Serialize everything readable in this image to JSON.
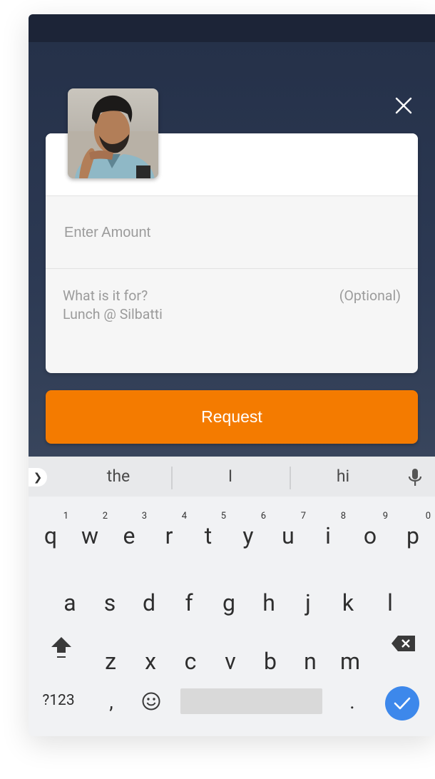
{
  "header": {
    "close_icon": "close-icon"
  },
  "request_form": {
    "amount_placeholder": "Enter Amount",
    "note_label": "What is it for?",
    "note_optional": "(Optional)",
    "note_placeholder": "Lunch @ Silbatti"
  },
  "request_button": {
    "label": "Request",
    "color": "#f47b00"
  },
  "keyboard": {
    "suggestions": [
      "the",
      "I",
      "hi"
    ],
    "row1": [
      {
        "key": "q",
        "hint": "1"
      },
      {
        "key": "w",
        "hint": "2"
      },
      {
        "key": "e",
        "hint": "3"
      },
      {
        "key": "r",
        "hint": "4"
      },
      {
        "key": "t",
        "hint": "5"
      },
      {
        "key": "y",
        "hint": "6"
      },
      {
        "key": "u",
        "hint": "7"
      },
      {
        "key": "i",
        "hint": "8"
      },
      {
        "key": "o",
        "hint": "9"
      },
      {
        "key": "p",
        "hint": "0"
      }
    ],
    "row2": [
      "a",
      "s",
      "d",
      "f",
      "g",
      "h",
      "j",
      "k",
      "l"
    ],
    "row3": [
      "z",
      "x",
      "c",
      "v",
      "b",
      "n",
      "m"
    ],
    "symbols_label": "?123",
    "comma": ",",
    "period": ".",
    "enter_color": "#3d88eb"
  }
}
